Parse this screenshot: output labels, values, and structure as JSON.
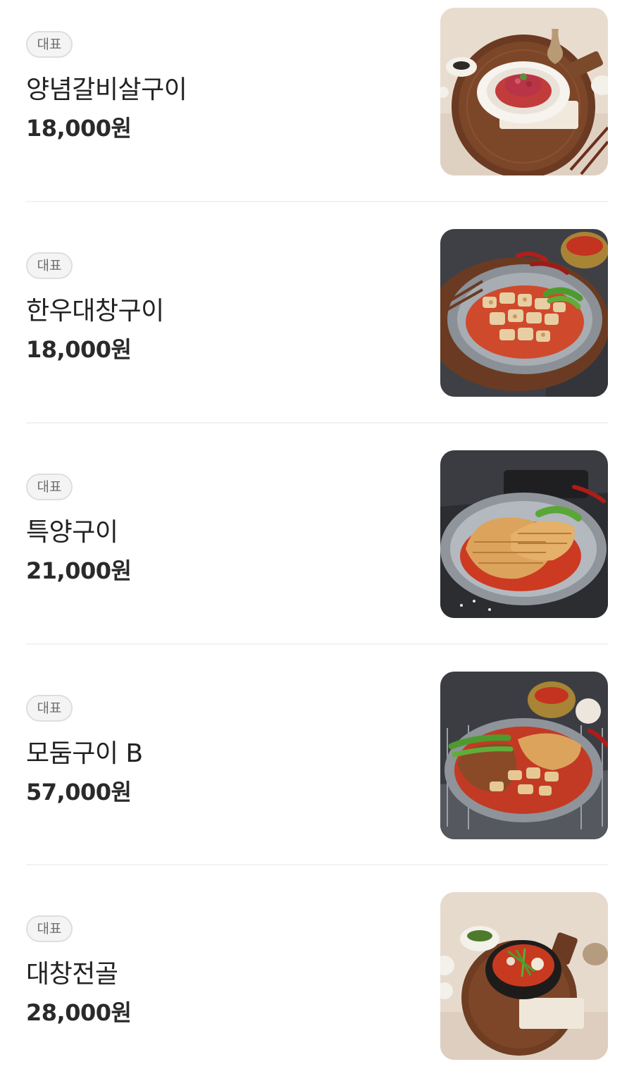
{
  "menu": {
    "items": [
      {
        "badge": "대표",
        "name": "양념갈비살구이",
        "price": "18,000원",
        "image": "seasoned-galbi-photo"
      },
      {
        "badge": "대표",
        "name": "한우대창구이",
        "price": "18,000원",
        "image": "hanwoo-daechang-photo"
      },
      {
        "badge": "대표",
        "name": "특양구이",
        "price": "21,000원",
        "image": "tripe-grill-photo"
      },
      {
        "badge": "대표",
        "name": "모둠구이 B",
        "price": "57,000원",
        "image": "assorted-grill-photo"
      },
      {
        "badge": "대표",
        "name": "대창전골",
        "price": "28,000원",
        "image": "daechang-hotpot-photo"
      }
    ]
  },
  "colors": {
    "badge_border": "#dedede",
    "divider": "#f2f2f2",
    "text": "#222222"
  }
}
